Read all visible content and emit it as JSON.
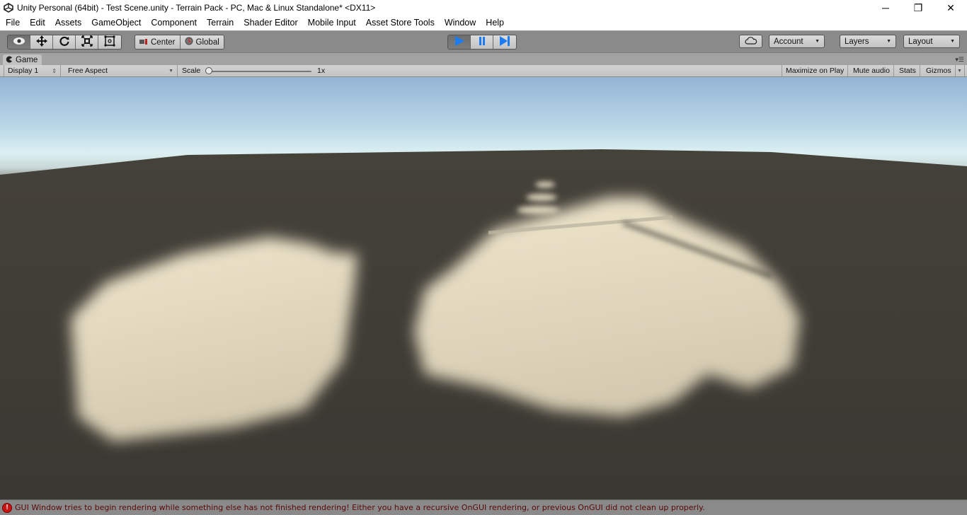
{
  "window": {
    "title": "Unity Personal (64bit) - Test Scene.unity - Terrain Pack - PC, Mac & Linux Standalone* <DX11>",
    "app_icon": "unity-logo-icon",
    "controls": {
      "minimize": "─",
      "restore": "❐",
      "close": "✕"
    }
  },
  "menubar": {
    "items": [
      {
        "label": "File"
      },
      {
        "label": "Edit"
      },
      {
        "label": "Assets"
      },
      {
        "label": "GameObject"
      },
      {
        "label": "Component"
      },
      {
        "label": "Terrain"
      },
      {
        "label": "Shader Editor"
      },
      {
        "label": "Mobile Input"
      },
      {
        "label": "Asset Store Tools"
      },
      {
        "label": "Window"
      },
      {
        "label": "Help"
      }
    ]
  },
  "toolbar": {
    "transform_tools": [
      {
        "name": "hand-view-tool",
        "icon": "eye-icon",
        "active": true
      },
      {
        "name": "move-tool",
        "icon": "move-arrows-icon",
        "active": false
      },
      {
        "name": "rotate-tool",
        "icon": "rotate-icon",
        "active": false
      },
      {
        "name": "scale-tool",
        "icon": "scale-icon",
        "active": false
      },
      {
        "name": "rect-tool",
        "icon": "rect-transform-icon",
        "active": false
      }
    ],
    "pivot_mode": "Center",
    "pivot_rotation": "Global",
    "play_controls": {
      "play": {
        "icon": "play-icon",
        "active": true
      },
      "pause": {
        "icon": "pause-icon",
        "active": false
      },
      "step": {
        "icon": "step-icon",
        "active": false
      }
    },
    "cloud_icon": "cloud-icon",
    "account_label": "Account",
    "layers_label": "Layers",
    "layout_label": "Layout",
    "accent_color": "#1a7cf0"
  },
  "game_view": {
    "tab_label": "Game",
    "tab_icon": "game-controller-icon",
    "display": "Display 1",
    "aspect": "Free Aspect",
    "scale_label": "Scale",
    "scale_value": "1x",
    "scale_fraction": 0.0,
    "maximize_on_play": "Maximize on Play",
    "mute_audio": "Mute audio",
    "stats": "Stats",
    "gizmos": "Gizmos",
    "scene_colors": {
      "sky_top": "#95b4d5",
      "horizon": "#dcf0f2",
      "ground": "#45423a",
      "terrain_light": "#ebe3cb"
    }
  },
  "status": {
    "icon": "error-icon",
    "message": "GUI Window tries to begin rendering while something else has not finished rendering! Either you have a recursive OnGUI rendering, or previous OnGUI did not clean up properly.",
    "color": "#5a0808"
  }
}
